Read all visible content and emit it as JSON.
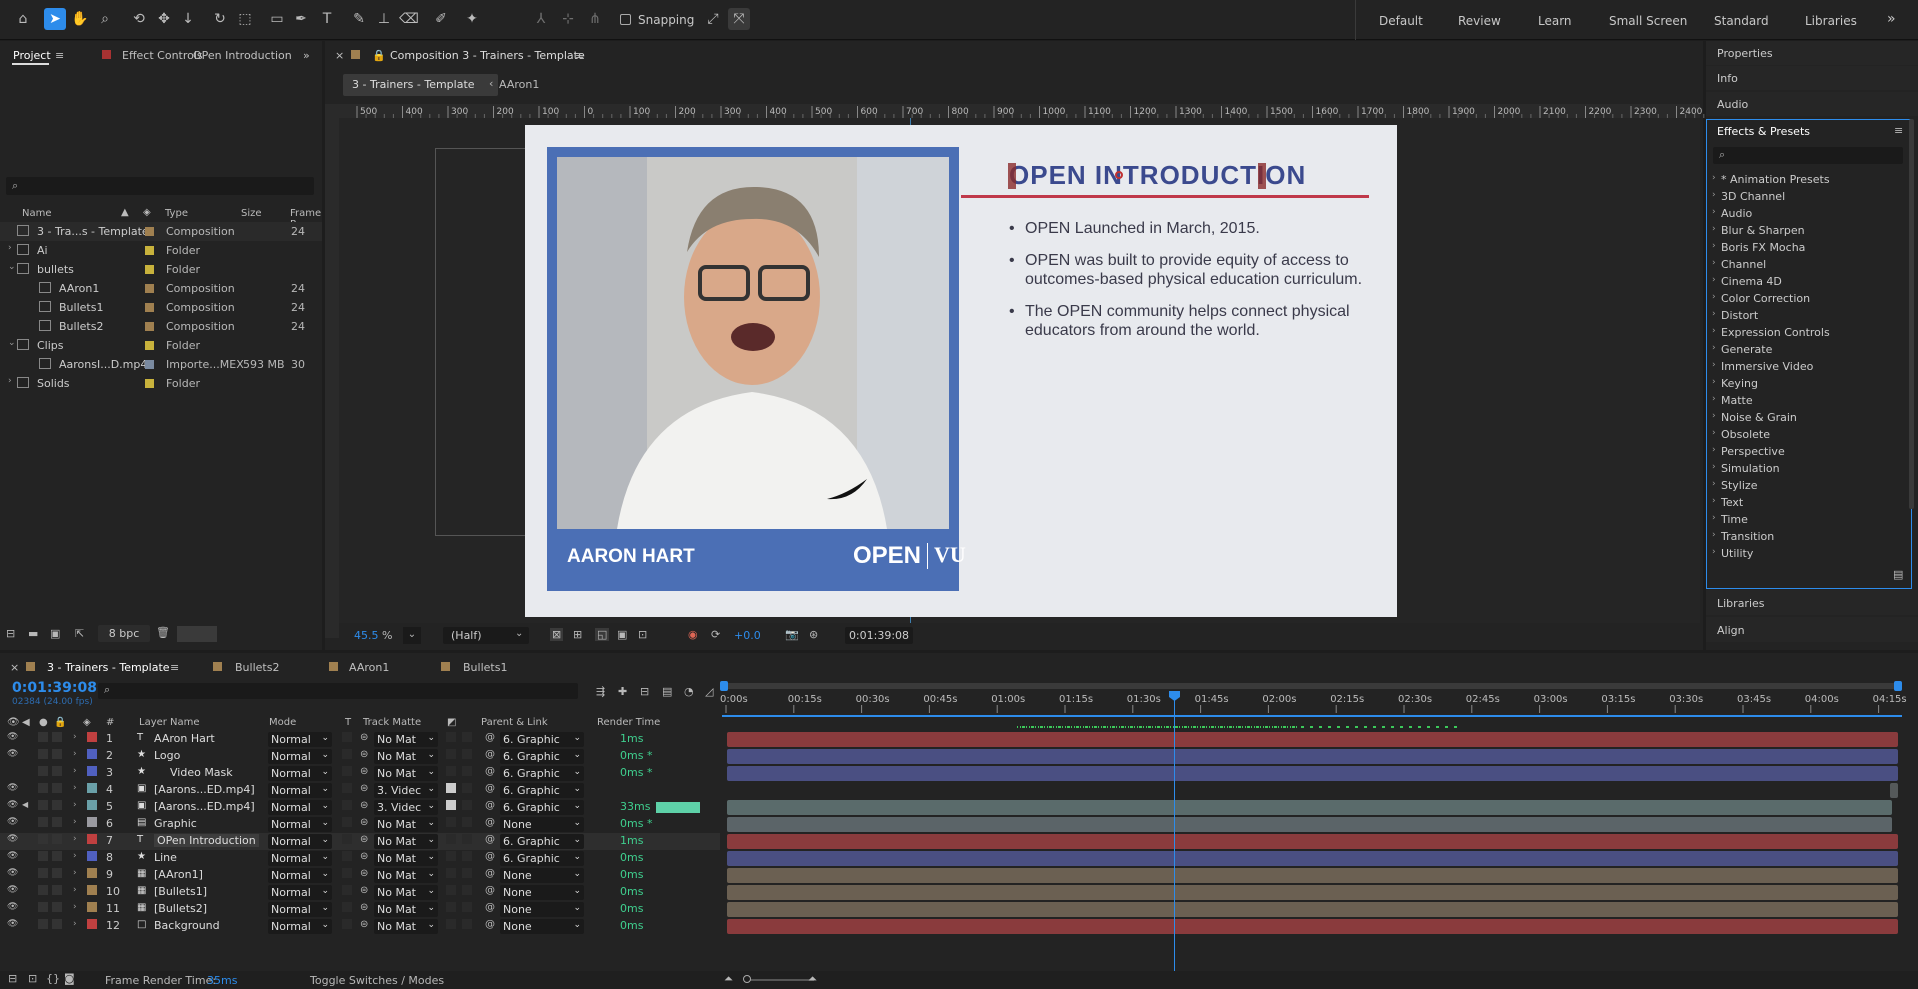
{
  "toolbar": {
    "snapping": "Snapping",
    "workspaces": [
      "Default",
      "Review",
      "Learn",
      "Small Screen",
      "Standard",
      "Libraries"
    ]
  },
  "project": {
    "tab": "Project",
    "effect_tab": "Effect Controls",
    "effect_target": "OPen Introduction",
    "cols": [
      "Name",
      "Type",
      "Size",
      "Frame R"
    ],
    "items": [
      {
        "name": "3 - Tra...s - Template",
        "type": "Composition",
        "size": "",
        "fr": "24",
        "color": "#a08050",
        "indent": 0,
        "expander": ""
      },
      {
        "name": "Ai",
        "type": "Folder",
        "size": "",
        "fr": "",
        "color": "#c8b23c",
        "indent": 0,
        "expander": "›"
      },
      {
        "name": "bullets",
        "type": "Folder",
        "size": "",
        "fr": "",
        "color": "#c8b23c",
        "indent": 0,
        "expander": "⌄"
      },
      {
        "name": "AAron1",
        "type": "Composition",
        "size": "",
        "fr": "24",
        "color": "#a08050",
        "indent": 1,
        "expander": ""
      },
      {
        "name": "Bullets1",
        "type": "Composition",
        "size": "",
        "fr": "24",
        "color": "#a08050",
        "indent": 1,
        "expander": ""
      },
      {
        "name": "Bullets2",
        "type": "Composition",
        "size": "",
        "fr": "24",
        "color": "#a08050",
        "indent": 1,
        "expander": ""
      },
      {
        "name": "Clips",
        "type": "Folder",
        "size": "",
        "fr": "",
        "color": "#c8b23c",
        "indent": 0,
        "expander": "⌄"
      },
      {
        "name": "AaronsI...D.mp4",
        "type": "Importe...MEX",
        "size": "593 MB",
        "fr": "30",
        "color": "#7a8aa0",
        "indent": 1,
        "expander": ""
      },
      {
        "name": "Solids",
        "type": "Folder",
        "size": "",
        "fr": "",
        "color": "#c8b23c",
        "indent": 0,
        "expander": "›"
      }
    ],
    "bpc": "8 bpc"
  },
  "comp": {
    "panel_title": "Composition 3 - Trainers - Template",
    "tab1": "3 - Trainers - Template",
    "tab2": "AAron1",
    "ruler": [
      "500",
      "400",
      "300",
      "200",
      "100",
      "0",
      "100",
      "200",
      "300",
      "400",
      "500",
      "600",
      "700",
      "800",
      "900",
      "1000",
      "1100",
      "1200",
      "1300",
      "1400",
      "1500",
      "1600",
      "1700",
      "1800",
      "1900",
      "2000",
      "2100",
      "2200",
      "2300",
      "2400"
    ],
    "zoom": "45.5",
    "zoom_unit": "%",
    "resolution": "(Half)",
    "exposure": "+0.0",
    "timecode": "0:01:39:08",
    "slide": {
      "heading": "OPEN INTRODUCTION",
      "name": "AARON HART",
      "logo1": "OPEN",
      "logo2": "VU",
      "bullets": [
        "OPEN Launched in March, 2015.",
        "OPEN was built to provide equity of access to outcomes-based physical education curriculum.",
        "The OPEN community helps connect physical educators from around the world."
      ]
    }
  },
  "right": {
    "properties": "Properties",
    "info": "Info",
    "audio": "Audio",
    "effects": "Effects & Presets",
    "list": [
      "* Animation Presets",
      "3D Channel",
      "Audio",
      "Blur & Sharpen",
      "Boris FX Mocha",
      "Channel",
      "Cinema 4D",
      "Color Correction",
      "Distort",
      "Expression Controls",
      "Generate",
      "Immersive Video",
      "Keying",
      "Matte",
      "Noise & Grain",
      "Obsolete",
      "Perspective",
      "Simulation",
      "Stylize",
      "Text",
      "Time",
      "Transition",
      "Utility"
    ],
    "libraries": "Libraries",
    "align": "Align"
  },
  "timeline": {
    "tab": "3 - Trainers - Template",
    "other_tabs": [
      "Bullets2",
      "AAron1",
      "Bullets1"
    ],
    "time": "0:01:39:08",
    "fps": "02384 (24.00 fps)",
    "cols": {
      "layer": "Layer Name",
      "mode": "Mode",
      "t": "T",
      "matte": "Track Matte",
      "parent": "Parent & Link",
      "render": "Render Time"
    },
    "ticks": [
      "0:00s",
      "00:15s",
      "00:30s",
      "00:45s",
      "01:00s",
      "01:15s",
      "01:30s",
      "01:45s",
      "02:00s",
      "02:15s",
      "02:30s",
      "02:45s",
      "03:00s",
      "03:15s",
      "03:30s",
      "03:45s",
      "04:00s",
      "04:15s"
    ],
    "layers": [
      {
        "n": "1",
        "name": "AAron Hart",
        "icon": "T",
        "color": "#c04040",
        "mode": "Normal",
        "matte": "No Mat",
        "parent": "6. Graphic",
        "render": "1ms",
        "bar": "#8a3b3d"
      },
      {
        "n": "2",
        "name": "Logo",
        "icon": "★",
        "color": "#5060c0",
        "mode": "Normal",
        "matte": "No Mat",
        "parent": "6. Graphic",
        "render": "0ms *",
        "bar": "#4a4f82"
      },
      {
        "n": "3",
        "name": "Video Mask",
        "icon": "★",
        "color": "#5060c0",
        "mode": "Normal",
        "matte": "No Mat",
        "parent": "6. Graphic",
        "render": "0ms *",
        "bar": "#4a4f82"
      },
      {
        "n": "4",
        "name": "[Aarons...ED.mp4]",
        "icon": "▣",
        "color": "#6aa0a8",
        "mode": "Normal",
        "matte": "3. Videc",
        "parent": "6. Graphic",
        "render": "",
        "bar": "#3a4446"
      },
      {
        "n": "5",
        "name": "[Aarons...ED.mp4]",
        "icon": "▣",
        "color": "#6aa0a8",
        "mode": "Normal",
        "matte": "3. Videc",
        "parent": "6. Graphic",
        "render": "33ms",
        "bar": "#5a6b6b"
      },
      {
        "n": "6",
        "name": "Graphic",
        "icon": "▤",
        "color": "#9a9aa0",
        "mode": "Normal",
        "matte": "No Mat",
        "parent": "None",
        "render": "0ms *",
        "bar": "#5b6468"
      },
      {
        "n": "7",
        "name": "OPen Introduction",
        "icon": "T",
        "color": "#c04040",
        "mode": "Normal",
        "matte": "No Mat",
        "parent": "6. Graphic",
        "render": "1ms",
        "bar": "#8a3b3d"
      },
      {
        "n": "8",
        "name": "Line",
        "icon": "★",
        "color": "#5060c0",
        "mode": "Normal",
        "matte": "No Mat",
        "parent": "6. Graphic",
        "render": "0ms",
        "bar": "#4a4f82"
      },
      {
        "n": "9",
        "name": "[AAron1]",
        "icon": "▦",
        "color": "#a08050",
        "mode": "Normal",
        "matte": "No Mat",
        "parent": "None",
        "render": "0ms",
        "bar": "#6b6052"
      },
      {
        "n": "10",
        "name": "[Bullets1]",
        "icon": "▦",
        "color": "#a08050",
        "mode": "Normal",
        "matte": "No Mat",
        "parent": "None",
        "render": "0ms",
        "bar": "#6b6052"
      },
      {
        "n": "11",
        "name": "[Bullets2]",
        "icon": "▦",
        "color": "#a08050",
        "mode": "Normal",
        "matte": "No Mat",
        "parent": "None",
        "render": "0ms",
        "bar": "#6b6052"
      },
      {
        "n": "12",
        "name": "Background",
        "icon": "□",
        "color": "#c04040",
        "mode": "Normal",
        "matte": "No Mat",
        "parent": "None",
        "render": "0ms",
        "bar": "#8a3b3d"
      }
    ],
    "frame_render_label": "Frame Render Time:",
    "frame_render_value": "35ms",
    "toggle": "Toggle Switches / Modes"
  }
}
